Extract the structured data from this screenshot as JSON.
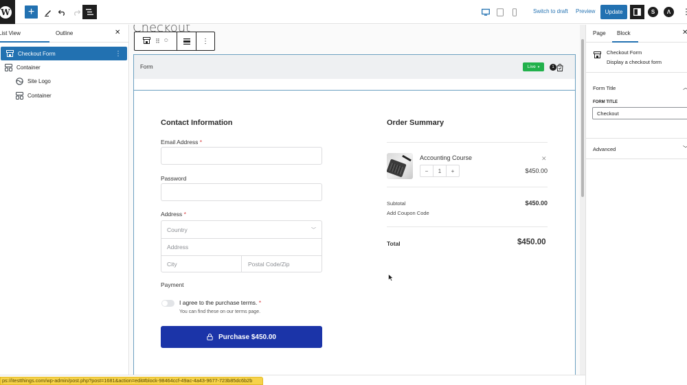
{
  "topbar": {
    "add_label": "+",
    "switch_to_draft": "Switch to draft",
    "preview": "Preview",
    "update": "Update",
    "active_device": "desktop",
    "accent": "#2271b1"
  },
  "list_view": {
    "tabs": [
      {
        "label": "List View",
        "active": true
      },
      {
        "label": "Outline",
        "active": false
      }
    ],
    "items": [
      {
        "label": "Checkout Form",
        "icon": "store-icon",
        "selected": true,
        "level": 0
      },
      {
        "label": "Container",
        "icon": "container-icon",
        "selected": false,
        "level": 0
      },
      {
        "label": "Site Logo",
        "icon": "site-logo-icon",
        "selected": false,
        "level": 1
      },
      {
        "label": "Container",
        "icon": "container-icon",
        "selected": false,
        "level": 1
      }
    ]
  },
  "canvas": {
    "page_title": "Checkout",
    "form_block": {
      "header_label": "Form",
      "status_badge": "Live",
      "cart_count": "1",
      "status_color": "#22b14c"
    },
    "contact": {
      "title": "Contact Information",
      "email_label": "Email Address",
      "email_value": "",
      "password_label": "Password",
      "password_value": "",
      "address_label": "Address",
      "required_mark": "*",
      "country_placeholder": "Country",
      "address_placeholder": "Address",
      "city_placeholder": "City",
      "zip_placeholder": "Postal Code/Zip",
      "payment_label": "Payment",
      "terms_label": "I agree to the purchase terms.",
      "terms_sub": "You can find these on our terms page.",
      "terms_checked": false,
      "purchase_button": "Purchase $450.00",
      "button_color": "#1b34a8"
    },
    "order_summary": {
      "title": "Order Summary",
      "items": [
        {
          "name": "Accounting Course",
          "quantity": "1",
          "price": "$450.00"
        }
      ],
      "qty_minus": "−",
      "qty_plus": "+",
      "subtotal_label": "Subtotal",
      "subtotal_value": "$450.00",
      "coupon_label": "Add Coupon Code",
      "total_label": "Total",
      "total_value": "$450.00"
    }
  },
  "settings": {
    "tabs": [
      {
        "label": "Page",
        "active": false
      },
      {
        "label": "Block",
        "active": true
      }
    ],
    "block_title": "Checkout Form",
    "block_description": "Display a checkout form",
    "sections": [
      {
        "title": "Form Title",
        "expanded": true,
        "field_label": "FORM TITLE",
        "field_value": "Checkout"
      },
      {
        "title": "Advanced",
        "expanded": false
      }
    ]
  },
  "status_bar": {
    "url": "ps://itestthings.com/wp-admin/post.php?post=1681&action=edit#block-98464ccf-49ac-4a43-9677-723b85dc6b2b"
  }
}
